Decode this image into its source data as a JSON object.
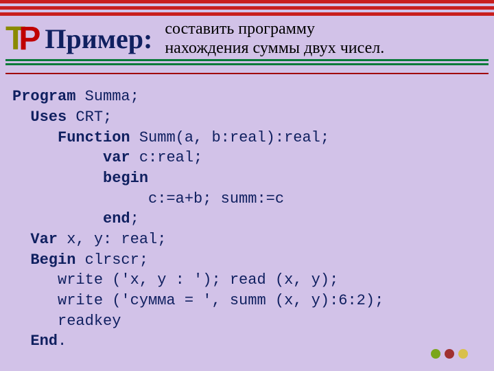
{
  "logo": {
    "t": "T",
    "p": "P"
  },
  "title": "Пример:",
  "subtitle_line1": "составить программу",
  "subtitle_line2": "нахождения суммы двух чисел.",
  "code": {
    "l01a": "Program",
    "l01b": " Summa;",
    "l02a": "  Uses",
    "l02b": " CRT;",
    "l03a": "     Function",
    "l03b": " Summ(a, b:real):real;",
    "l04a": "          var",
    "l04b": " c:real;",
    "l05a": "          begin",
    "l06": "               c:=a+b; summ:=c",
    "l07a": "          end",
    "l07b": ";",
    "l08a": "  Var",
    "l08b": " x, y: real;",
    "l09a": "  Begin",
    "l09b": " clrscr;",
    "l10": "     write ('x, y : '); read (x, y);",
    "l11": "     write ('сумма = ', summ (x, y):6:2);",
    "l12": "     readkey",
    "l13a": "  End",
    "l13b": "."
  }
}
